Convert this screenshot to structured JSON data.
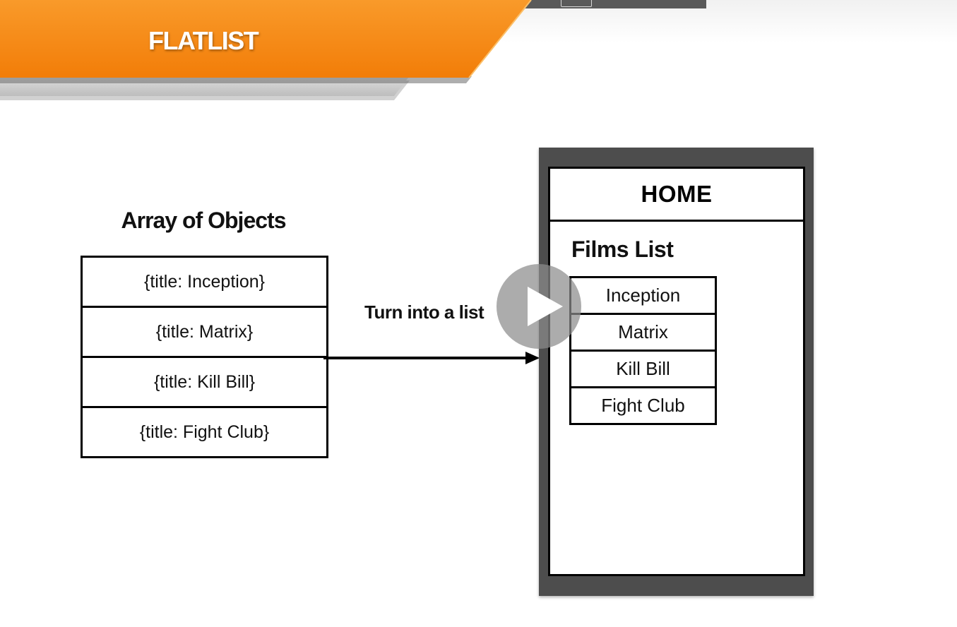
{
  "slide": {
    "title": "FLATLIST"
  },
  "array": {
    "heading": "Array of Objects",
    "items": [
      "{title: Inception}",
      "{title: Matrix}",
      "{title: Kill Bill}",
      "{title: Fight Club}"
    ]
  },
  "arrow": {
    "label": "Turn into a list"
  },
  "phone": {
    "header": "HOME",
    "list_heading": "Films List",
    "items": [
      "Inception",
      "Matrix",
      "Kill Bill",
      "Fight Club"
    ]
  },
  "player": {
    "play_icon": "play-icon"
  },
  "colors": {
    "banner_orange": "#f7830f",
    "banner_gray": "#c9c9c9",
    "phone_frame": "#4d4d4d",
    "play_overlay": "#8c8c8c"
  }
}
